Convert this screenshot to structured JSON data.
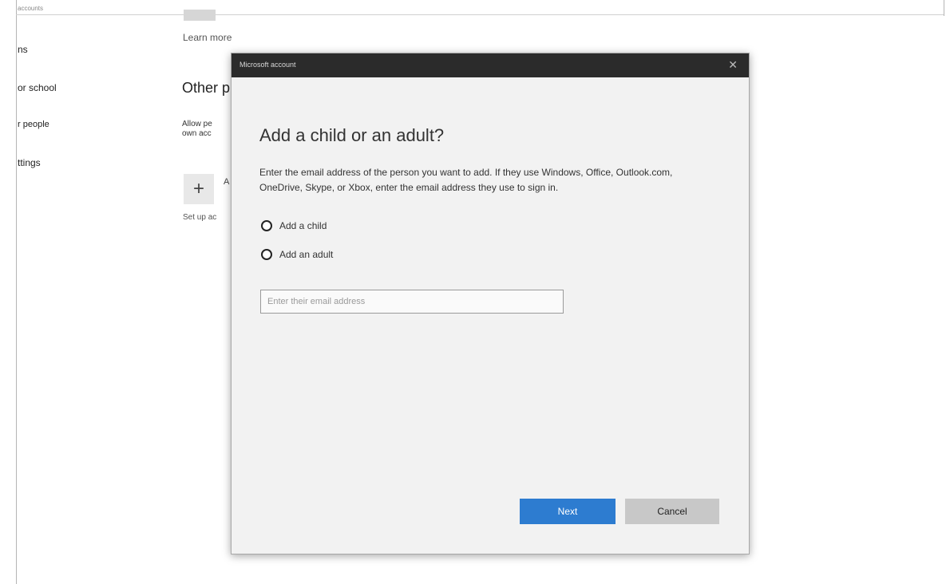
{
  "sidebar": {
    "top_fragment": "accounts",
    "items": [
      {
        "label": "ns"
      },
      {
        "label": "or school"
      },
      {
        "label": "r people"
      },
      {
        "label": "ttings"
      }
    ]
  },
  "main": {
    "learn_more": "Learn more",
    "other_heading": "Other p",
    "allow_line1": "Allow pe",
    "allow_line2": "own acc",
    "plus_label": "A",
    "setup_text": "Set up ac"
  },
  "dialog": {
    "title": "Microsoft account",
    "close_glyph": "✕",
    "heading": "Add a child or an adult?",
    "description": "Enter the email address of the person you want to add. If they use Windows, Office, Outlook.com, OneDrive, Skype, or Xbox, enter the email address they use to sign in.",
    "options": [
      {
        "label": "Add a child"
      },
      {
        "label": "Add an adult"
      }
    ],
    "email_placeholder": "Enter their email address",
    "next_label": "Next",
    "cancel_label": "Cancel"
  }
}
